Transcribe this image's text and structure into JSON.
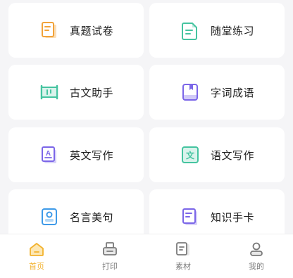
{
  "cards": [
    {
      "label": "真题试卷",
      "icon": "exam-paper-icon",
      "color": "#f2a33a"
    },
    {
      "label": "随堂练习",
      "icon": "practice-doc-icon",
      "color": "#45c4a0"
    },
    {
      "label": "古文助手",
      "icon": "ancient-scroll-icon",
      "color": "#45c4a0"
    },
    {
      "label": "字词成语",
      "icon": "book-icon",
      "color": "#7b66e8"
    },
    {
      "label": "英文写作",
      "icon": "english-writing-icon",
      "color": "#7b66e8",
      "glyph": "A"
    },
    {
      "label": "语文写作",
      "icon": "chinese-writing-icon",
      "color": "#45c4a0",
      "glyph": "文"
    },
    {
      "label": "名言美句",
      "icon": "quote-card-icon",
      "color": "#3e9ae8"
    },
    {
      "label": "知识手卡",
      "icon": "knowledge-card-icon",
      "color": "#7b66e8"
    }
  ],
  "tabbar": {
    "active_color": "#f2b22e",
    "tabs": [
      {
        "label": "首页",
        "icon": "home-icon",
        "active": true
      },
      {
        "label": "打印",
        "icon": "printer-icon",
        "active": false
      },
      {
        "label": "素材",
        "icon": "material-icon",
        "active": false
      },
      {
        "label": "我的",
        "icon": "profile-icon",
        "active": false
      }
    ]
  }
}
